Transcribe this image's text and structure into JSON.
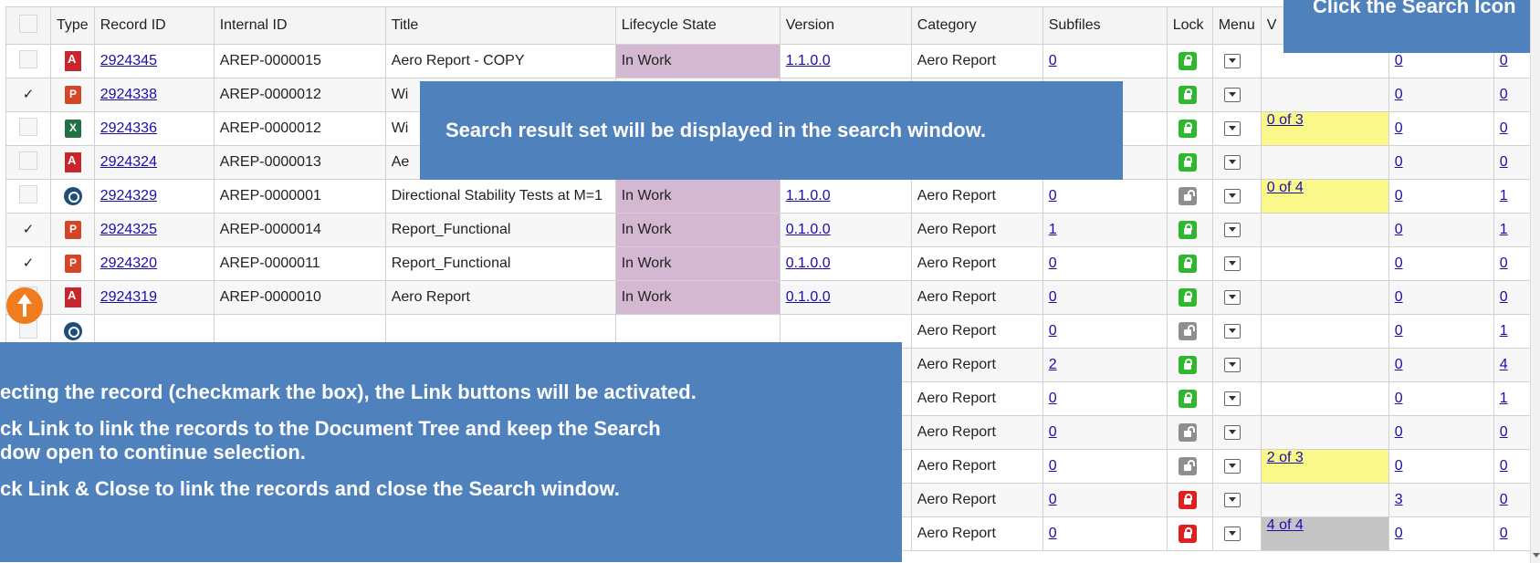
{
  "headers": [
    "",
    "Type",
    "Record ID",
    "Internal ID",
    "Title",
    "Lifecycle State",
    "Version",
    "Category",
    "Subfiles",
    "Lock",
    "Menu",
    "V",
    "",
    ""
  ],
  "rows": [
    {
      "checked": false,
      "type": "pdf",
      "record_id": "2924345",
      "internal_id": "AREP-0000015",
      "title": "Aero Report - COPY",
      "state": "In Work",
      "version": "1.1.0.0",
      "category": "Aero Report",
      "subfiles": "0",
      "lock": "locked-green",
      "wf": "",
      "wf_style": "",
      "c12": "0",
      "c13": "0"
    },
    {
      "checked": true,
      "type": "ppt",
      "record_id": "2924338",
      "internal_id": "AREP-0000012",
      "title": "Wi",
      "state": "",
      "version": "",
      "category": "",
      "subfiles": "",
      "lock": "locked-green",
      "wf": "",
      "wf_style": "",
      "c12": "0",
      "c13": "0"
    },
    {
      "checked": false,
      "type": "xls",
      "record_id": "2924336",
      "internal_id": "AREP-0000012",
      "title": "Wi",
      "state": "",
      "version": "",
      "category": "",
      "subfiles": "",
      "lock": "locked-green",
      "wf": "0 of 3",
      "wf_style": "y",
      "c12": "0",
      "c13": "0"
    },
    {
      "checked": false,
      "type": "pdf",
      "record_id": "2924324",
      "internal_id": "AREP-0000013",
      "title": "Ae",
      "state": "",
      "version": "",
      "category": "",
      "subfiles": "",
      "lock": "locked-green",
      "wf": "",
      "wf_style": "",
      "c12": "0",
      "c13": "0"
    },
    {
      "checked": false,
      "type": "gen",
      "record_id": "2924329",
      "internal_id": "AREP-0000001",
      "title": "Directional Stability Tests at M=1",
      "state": "In Work",
      "version": "1.1.0.0",
      "category": "Aero Report",
      "subfiles": "0",
      "lock": "unlocked",
      "wf": "0 of 4",
      "wf_style": "y",
      "c12": "0",
      "c13": "1"
    },
    {
      "checked": true,
      "type": "ppt",
      "record_id": "2924325",
      "internal_id": "AREP-0000014",
      "title": "Report_Functional",
      "state": "In Work",
      "version": "0.1.0.0",
      "category": "Aero Report",
      "subfiles": "1",
      "lock": "locked-green",
      "wf": "",
      "wf_style": "",
      "c12": "0",
      "c13": "1"
    },
    {
      "checked": true,
      "type": "ppt",
      "record_id": "2924320",
      "internal_id": "AREP-0000011",
      "title": "Report_Functional",
      "state": "In Work",
      "version": "0.1.0.0",
      "category": "Aero Report",
      "subfiles": "0",
      "lock": "locked-green",
      "wf": "",
      "wf_style": "",
      "c12": "0",
      "c13": "0"
    },
    {
      "checked": false,
      "type": "pdf",
      "record_id": "2924319",
      "internal_id": "AREP-0000010",
      "title": "Aero Report",
      "state": "In Work",
      "version": "0.1.0.0",
      "category": "Aero Report",
      "subfiles": "0",
      "lock": "locked-green",
      "wf": "",
      "wf_style": "",
      "c12": "0",
      "c13": "0"
    },
    {
      "checked": false,
      "type": "gen",
      "record_id": "",
      "internal_id": "",
      "title": "",
      "state": "",
      "version": "",
      "category": "Aero Report",
      "subfiles": "0",
      "lock": "unlocked",
      "wf": "",
      "wf_style": "",
      "c12": "0",
      "c13": "1"
    },
    {
      "checked": false,
      "type": "",
      "record_id": "",
      "internal_id": "",
      "title": "",
      "state": "",
      "version": "",
      "category": "Aero Report",
      "subfiles": "2",
      "lock": "locked-green",
      "wf": "",
      "wf_style": "",
      "c12": "0",
      "c13": "4"
    },
    {
      "checked": false,
      "type": "",
      "record_id": "",
      "internal_id": "",
      "title": "",
      "state": "",
      "version": "",
      "category": "Aero Report",
      "subfiles": "0",
      "lock": "locked-green",
      "wf": "",
      "wf_style": "",
      "c12": "0",
      "c13": "1"
    },
    {
      "checked": false,
      "type": "",
      "record_id": "",
      "internal_id": "",
      "title": "",
      "state": "",
      "version": "",
      "category": "Aero Report",
      "subfiles": "0",
      "lock": "unlocked",
      "wf": "",
      "wf_style": "",
      "c12": "0",
      "c13": "0"
    },
    {
      "checked": false,
      "type": "",
      "record_id": "",
      "internal_id": "",
      "title": "",
      "state": "",
      "version": "",
      "category": "Aero Report",
      "subfiles": "0",
      "lock": "unlocked",
      "wf": "2 of 3",
      "wf_style": "y",
      "c12": "0",
      "c13": "0"
    },
    {
      "checked": false,
      "type": "",
      "record_id": "",
      "internal_id": "",
      "title": "",
      "state": "",
      "version": "",
      "category": "Aero Report",
      "subfiles": "0",
      "lock": "locked-red",
      "wf": "",
      "wf_style": "",
      "c12": "3",
      "c13": "0"
    },
    {
      "checked": false,
      "type": "",
      "record_id": "",
      "internal_id": "",
      "title": "",
      "state": "",
      "version": "",
      "category": "Aero Report",
      "subfiles": "0",
      "lock": "locked-red",
      "wf": "4 of 4",
      "wf_style": "g",
      "c12": "0",
      "c13": "0"
    }
  ],
  "callouts": {
    "search_result": "Search result set will be displayed in the search window.",
    "search_icon": "Click the Search Icon",
    "link_line1": "ecting the record (checkmark the box), the Link buttons will be activated.",
    "link_line2a": "ck Link to link the records to the Document Tree and keep the Search",
    "link_line2b": "dow open to continue selection.",
    "link_line3": "ck Link & Close to link the records and close the Search window."
  },
  "colors": {
    "callout": "#4f81bd",
    "lifecycle": "#d4b8d2",
    "workflow_pending": "#fbf88a",
    "workflow_done": "#c4c4c4"
  }
}
